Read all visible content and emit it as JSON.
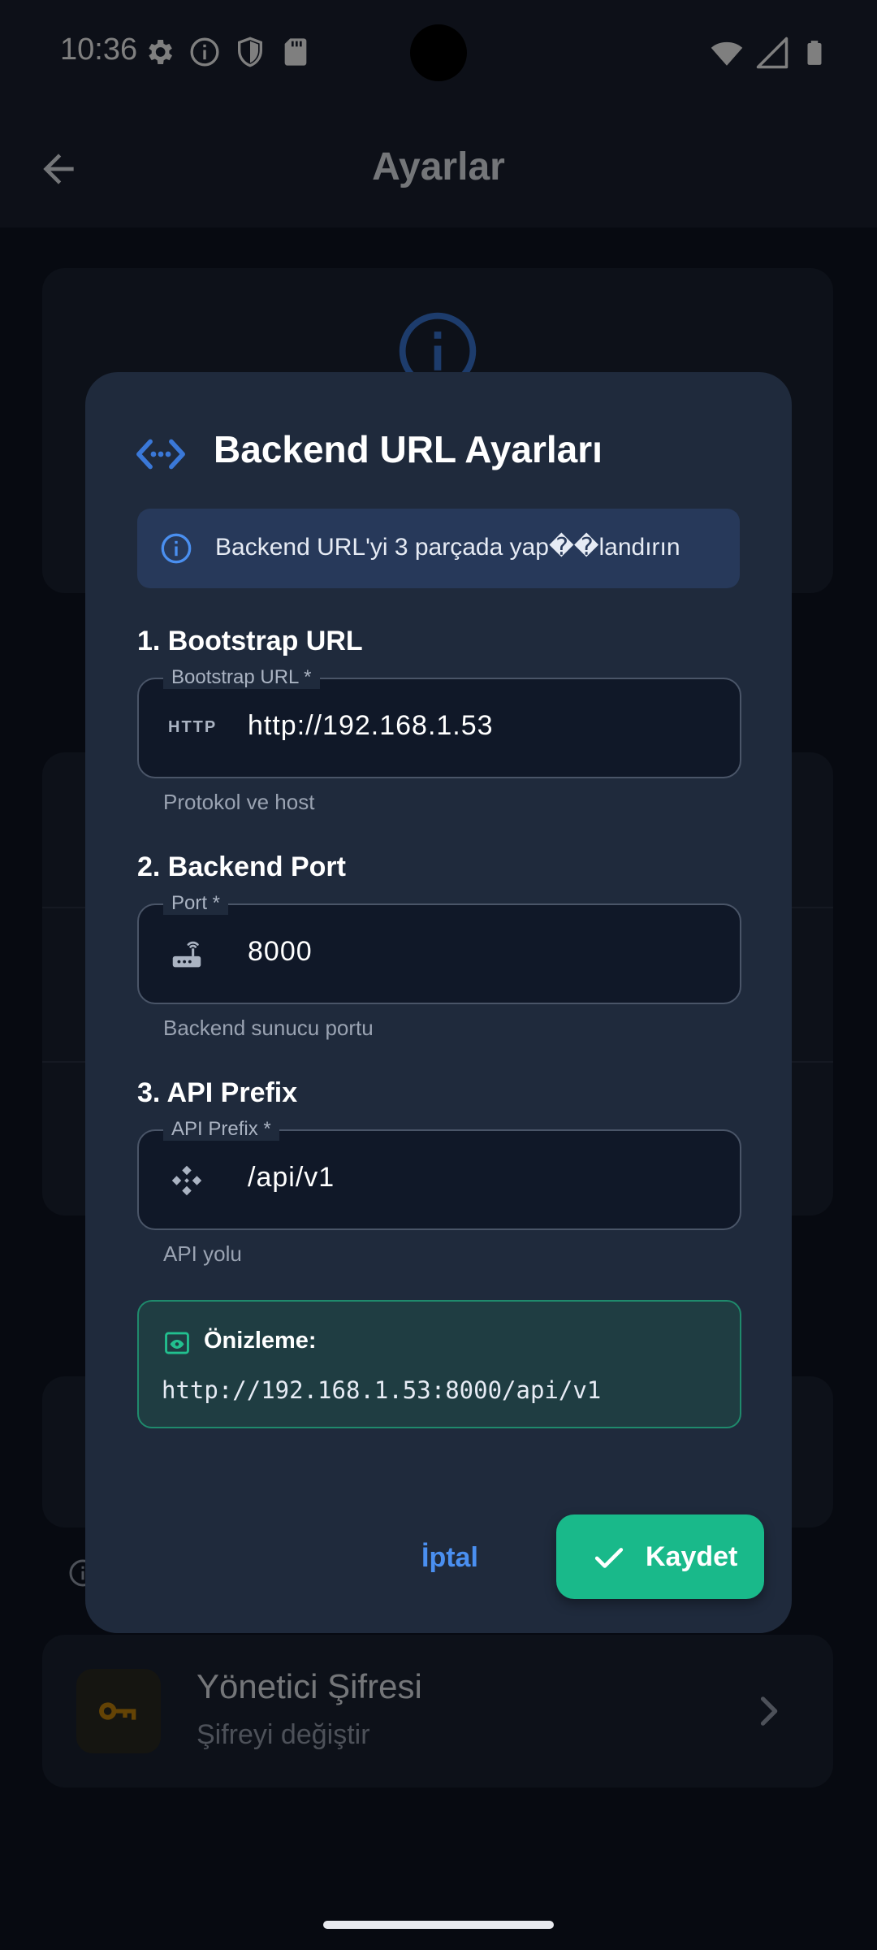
{
  "status_bar": {
    "time": "10:36",
    "left_icons": [
      "gear-icon",
      "info-icon",
      "shield-icon",
      "sd-card-icon"
    ],
    "right_icons": [
      "wifi-icon",
      "signal-icon",
      "battery-icon"
    ]
  },
  "app_bar": {
    "title": "Ayarlar",
    "back_icon": "arrow-left-icon"
  },
  "background": {
    "admin_password": {
      "title": "Yönetici Şifresi",
      "subtitle": "Şifreyi değiştir",
      "icon": "key-icon",
      "icon_color": "#c8860a"
    }
  },
  "dialog": {
    "title": "Backend URL Ayarları",
    "title_icon": "code-icon",
    "info_text": "Backend URL'yi 3 parçada yap��landırın",
    "sections": [
      {
        "heading": "1. Bootstrap URL",
        "field_label": "Bootstrap URL *",
        "icon_text": "HTTP",
        "value": "http://192.168.1.53",
        "helper": "Protokol ve host"
      },
      {
        "heading": "2. Backend Port",
        "field_label": "Port *",
        "icon": "router-icon",
        "value": "8000",
        "helper": "Backend sunucu portu"
      },
      {
        "heading": "3. API Prefix",
        "field_label": "API Prefix *",
        "icon": "api-icon",
        "value": "/api/v1",
        "helper": "API yolu"
      }
    ],
    "preview": {
      "label": "Önizleme:",
      "icon": "preview-icon",
      "url": "http://192.168.1.53:8000/api/v1"
    },
    "cancel_label": "İptal",
    "save_label": "Kaydet"
  },
  "colors": {
    "accent_blue": "#4a8ff0",
    "save_green": "#19b98a",
    "dialog_bg": "#1f2a3c"
  }
}
